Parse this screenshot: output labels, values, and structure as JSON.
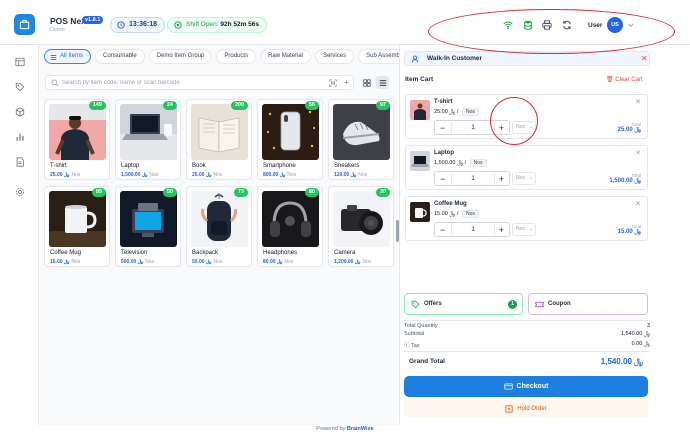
{
  "app": {
    "name": "POS Next",
    "version": "v1.8.1",
    "subtitle": "Demo"
  },
  "header": {
    "time": "13:36:18",
    "shift_label": "Shift Open:",
    "shift_duration": "92h 52m 56s",
    "user_label": "User",
    "user_initials": "US"
  },
  "tabs": [
    {
      "label": "All Items",
      "active": true
    },
    {
      "label": "Consumable"
    },
    {
      "label": "Demo Item Group"
    },
    {
      "label": "Products"
    },
    {
      "label": "Raw Material"
    },
    {
      "label": "Services"
    },
    {
      "label": "Sub Assemblies"
    }
  ],
  "search": {
    "placeholder": "Search by item code, name or scan barcode"
  },
  "currency_symbol": "﷼",
  "items": [
    {
      "name": "T-shirt",
      "price": "25.00",
      "uom": "Nos",
      "stock": "149"
    },
    {
      "name": "Laptop",
      "price": "1,500.00",
      "uom": "Nos",
      "stock": "24"
    },
    {
      "name": "Book",
      "price": "25.00",
      "uom": "Nos",
      "stock": "200"
    },
    {
      "name": "Smartphone",
      "price": "800.00",
      "uom": "Nos",
      "stock": "56"
    },
    {
      "name": "Sneakers",
      "price": "120.00",
      "uom": "Nos",
      "stock": "97"
    },
    {
      "name": "Coffee Mug",
      "price": "15.00",
      "uom": "Nos",
      "stock": "99"
    },
    {
      "name": "Television",
      "price": "500.00",
      "uom": "Nos",
      "stock": "50"
    },
    {
      "name": "Backpack",
      "price": "50.00",
      "uom": "Nos",
      "stock": "73"
    },
    {
      "name": "Headphones",
      "price": "80.00",
      "uom": "Nos",
      "stock": "80"
    },
    {
      "name": "Camera",
      "price": "1,200.00",
      "uom": "Nos",
      "stock": "30"
    }
  ],
  "customer": {
    "name": "Walk-In Customer"
  },
  "cart": {
    "title": "Item Cart",
    "clear_label": "Clear Cart",
    "total_label": "Total",
    "lines": [
      {
        "name": "T-shirt",
        "rate": "25.00",
        "uom": "Nos",
        "qty": "1",
        "uom_select": "Nos",
        "total": "25.00"
      },
      {
        "name": "Laptop",
        "rate": "1,500.00",
        "uom": "Nos",
        "qty": "1",
        "uom_select": "Nos",
        "total": "1,500.00"
      },
      {
        "name": "Coffee Mug",
        "rate": "15.00",
        "uom": "Nos",
        "qty": "1",
        "uom_select": "Nos",
        "total": "15.00"
      }
    ]
  },
  "promo": {
    "offers_label": "Offers",
    "offers_count": "1",
    "coupon_label": "Coupon"
  },
  "summary": {
    "total_qty_label": "Total Quantity",
    "total_qty": "3",
    "subtotal_label": "Subtotal",
    "subtotal": "1,540.00",
    "tax_label": "Tax",
    "tax": "0.00",
    "grand_label": "Grand Total",
    "grand": "1,540.00"
  },
  "actions": {
    "checkout": "Checkout",
    "hold": "Hold Order"
  },
  "footer": {
    "prefix": "Powered by",
    "brand": "BrainWise"
  }
}
